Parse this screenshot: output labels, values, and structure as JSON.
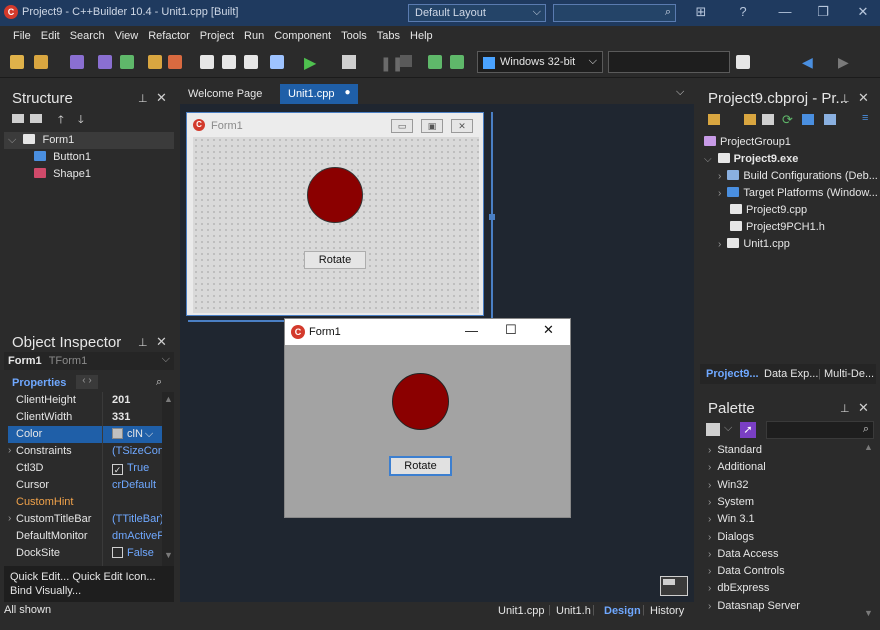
{
  "window": {
    "title": "Project9 - C++Builder 10.4 - Unit1.cpp [Built]",
    "app_icon_letter": "C",
    "layout_combo": "Default Layout",
    "controls": [
      "?",
      "—",
      "❐",
      "✕"
    ]
  },
  "menu": [
    "File",
    "Edit",
    "Search",
    "View",
    "Refactor",
    "Project",
    "Run",
    "Component",
    "Tools",
    "Tabs",
    "Help"
  ],
  "toolbar": {
    "platform": "Windows 32-bit"
  },
  "structure": {
    "title": "Structure",
    "items": [
      {
        "label": "Form1",
        "level": 0
      },
      {
        "label": "Button1",
        "level": 1
      },
      {
        "label": "Shape1",
        "level": 1
      }
    ]
  },
  "inspector": {
    "title": "Object Inspector",
    "object_name": "Form1",
    "object_type": "TForm1",
    "tab": "Properties",
    "rows": [
      {
        "name": "ClientHeight",
        "value": "201",
        "expand": false,
        "bold": true
      },
      {
        "name": "ClientWidth",
        "value": "331",
        "expand": false,
        "bold": true
      },
      {
        "name": "Color",
        "value": "clN",
        "expand": false,
        "selected": true
      },
      {
        "name": "Constraints",
        "value": "(TSizeCons",
        "expand": true
      },
      {
        "name": "Ctl3D",
        "value": "True",
        "expand": false,
        "checkbox": true,
        "checked": true
      },
      {
        "name": "Cursor",
        "value": "crDefault",
        "expand": false
      },
      {
        "name": "CustomHint",
        "value": "",
        "expand": false,
        "highlight": true
      },
      {
        "name": "CustomTitleBar",
        "value": "(TTitleBar)",
        "expand": true
      },
      {
        "name": "DefaultMonitor",
        "value": "dmActiveF",
        "expand": false
      },
      {
        "name": "DockSite",
        "value": "False",
        "expand": false,
        "checkbox": true,
        "checked": false
      }
    ],
    "footer_line1": "Quick Edit...  Quick Edit Icon...",
    "footer_line2": "Bind Visually...",
    "status": "All shown"
  },
  "editor": {
    "tabs": [
      "Welcome Page",
      "Unit1.cpp"
    ],
    "active_tab": "Unit1.cpp",
    "bottom_tabs": [
      "Unit1.cpp",
      "Unit1.h",
      "Design",
      "History"
    ],
    "active_bottom": "Design"
  },
  "design_form": {
    "caption": "Form1",
    "button_label": "Rotate",
    "shape_color": "#8b0000"
  },
  "running_form": {
    "caption": "Form1",
    "button_label": "Rotate",
    "shape_color": "#8b0000",
    "controls": [
      "—",
      "☐",
      "✕"
    ]
  },
  "project": {
    "title": "Project9.cbproj - Pr...",
    "items": [
      {
        "label": "ProjectGroup1",
        "level": 0,
        "bold": false
      },
      {
        "label": "Project9.exe",
        "level": 0,
        "bold": true,
        "expanded": true
      },
      {
        "label": "Build Configurations (Deb...",
        "level": 1,
        "expand": true
      },
      {
        "label": "Target Platforms (Window...",
        "level": 1,
        "expand": true
      },
      {
        "label": "Project9.cpp",
        "level": 1
      },
      {
        "label": "Project9PCH1.h",
        "level": 1
      },
      {
        "label": "Unit1.cpp",
        "level": 1,
        "expand": true
      }
    ],
    "tabs": [
      "Project9...",
      "Data Exp...",
      "Multi-De..."
    ]
  },
  "palette": {
    "title": "Palette",
    "items": [
      "Standard",
      "Additional",
      "Win32",
      "System",
      "Win 3.1",
      "Dialogs",
      "Data Access",
      "Data Controls",
      "dbExpress",
      "Datasnap Server"
    ]
  },
  "colors": {
    "accent": "#4a7fc4",
    "titlebar": "#1f3a5f",
    "panel": "#2b2b2b",
    "highlight_text": "#f0a24a",
    "link_text": "#6fa8ff"
  }
}
